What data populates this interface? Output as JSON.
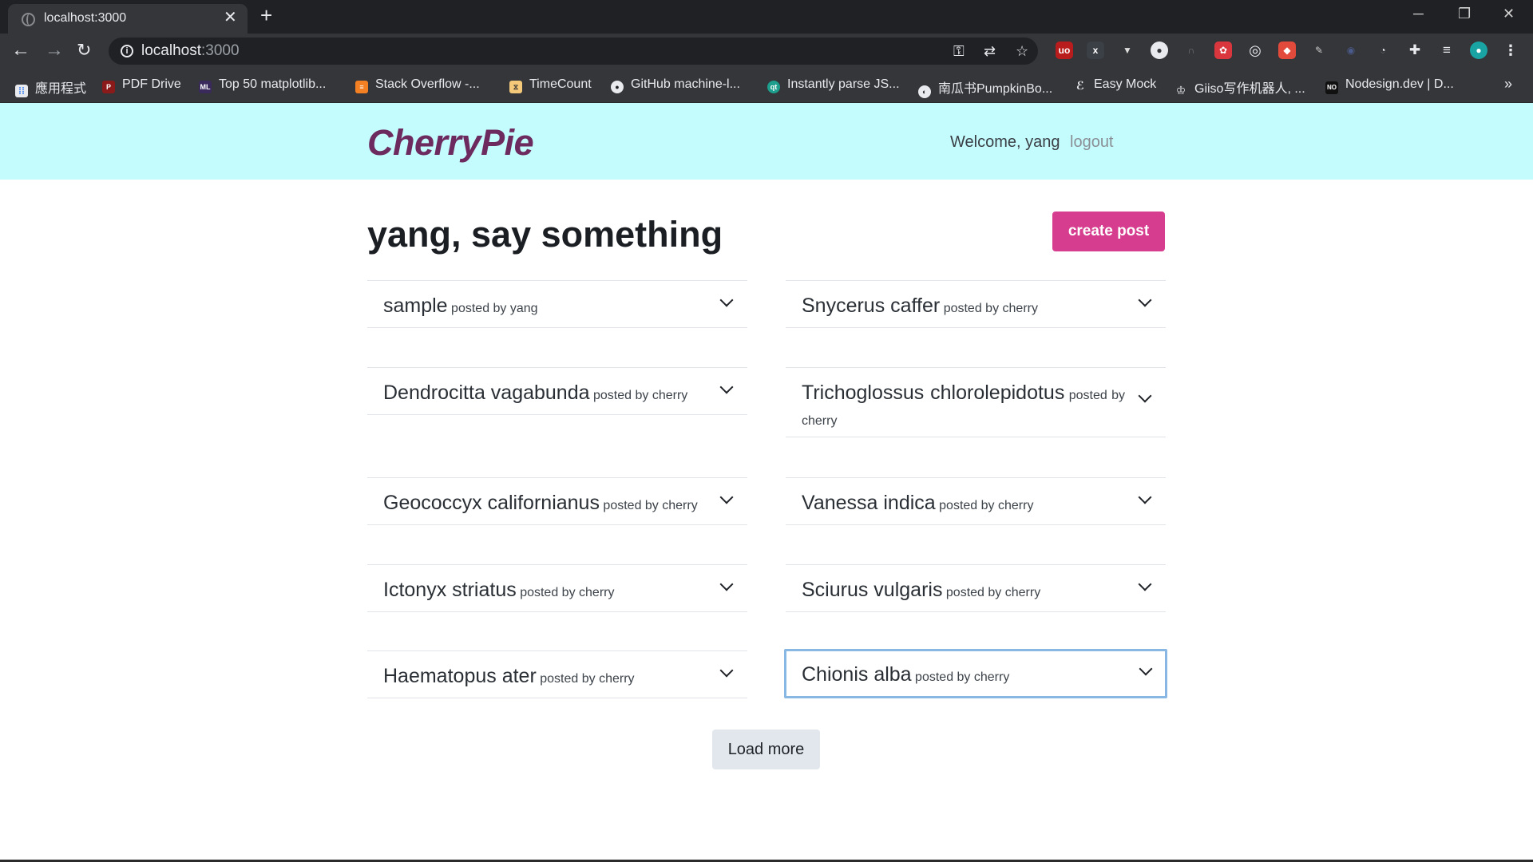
{
  "browser": {
    "tab_title": "localhost:3000",
    "url_host": "localhost",
    "url_port": ":3000",
    "bookmarks": [
      {
        "label": "應用程式",
        "icon": "apps-grid-icon"
      },
      {
        "label": "PDF Drive",
        "icon": "pdf-drive-icon"
      },
      {
        "label": "Top 50 matplotlib...",
        "icon": "ml-icon"
      },
      {
        "label": "Stack Overflow -...",
        "icon": "stackoverflow-icon"
      },
      {
        "label": "TimeCount",
        "icon": "timecount-icon"
      },
      {
        "label": "GitHub machine-l...",
        "icon": "github-icon"
      },
      {
        "label": "Instantly parse JS...",
        "icon": "quicktype-icon"
      },
      {
        "label": "南瓜书PumpkinBo...",
        "icon": "globe-icon"
      },
      {
        "label": "Easy Mock",
        "icon": "easymock-icon"
      },
      {
        "label": "Giiso写作机器人, ...",
        "icon": "giiso-icon"
      },
      {
        "label": "Nodesign.dev | D...",
        "icon": "nodesign-icon"
      }
    ]
  },
  "header": {
    "brand": "CherryPie",
    "welcome": "Welcome, yang",
    "logout": "logout"
  },
  "main": {
    "title": "yang, say something",
    "create_button": "create post",
    "posts": [
      {
        "title": "sample",
        "byline": "posted by yang"
      },
      {
        "title": "Snycerus caffer",
        "byline": "posted by cherry"
      },
      {
        "title": "Dendrocitta vagabunda",
        "byline": "posted by cherry"
      },
      {
        "title": "Trichoglossus chlorolepidotus",
        "byline": "posted by cherry"
      },
      {
        "title": "Geococcyx californianus",
        "byline": "posted by cherry"
      },
      {
        "title": "Vanessa indica",
        "byline": "posted by cherry"
      },
      {
        "title": "Ictonyx striatus",
        "byline": "posted by cherry"
      },
      {
        "title": "Sciurus vulgaris",
        "byline": "posted by cherry"
      },
      {
        "title": "Haematopus ater",
        "byline": "posted by cherry"
      },
      {
        "title": "Chionis alba",
        "byline": "posted by cherry"
      }
    ],
    "load_more": "Load more"
  }
}
